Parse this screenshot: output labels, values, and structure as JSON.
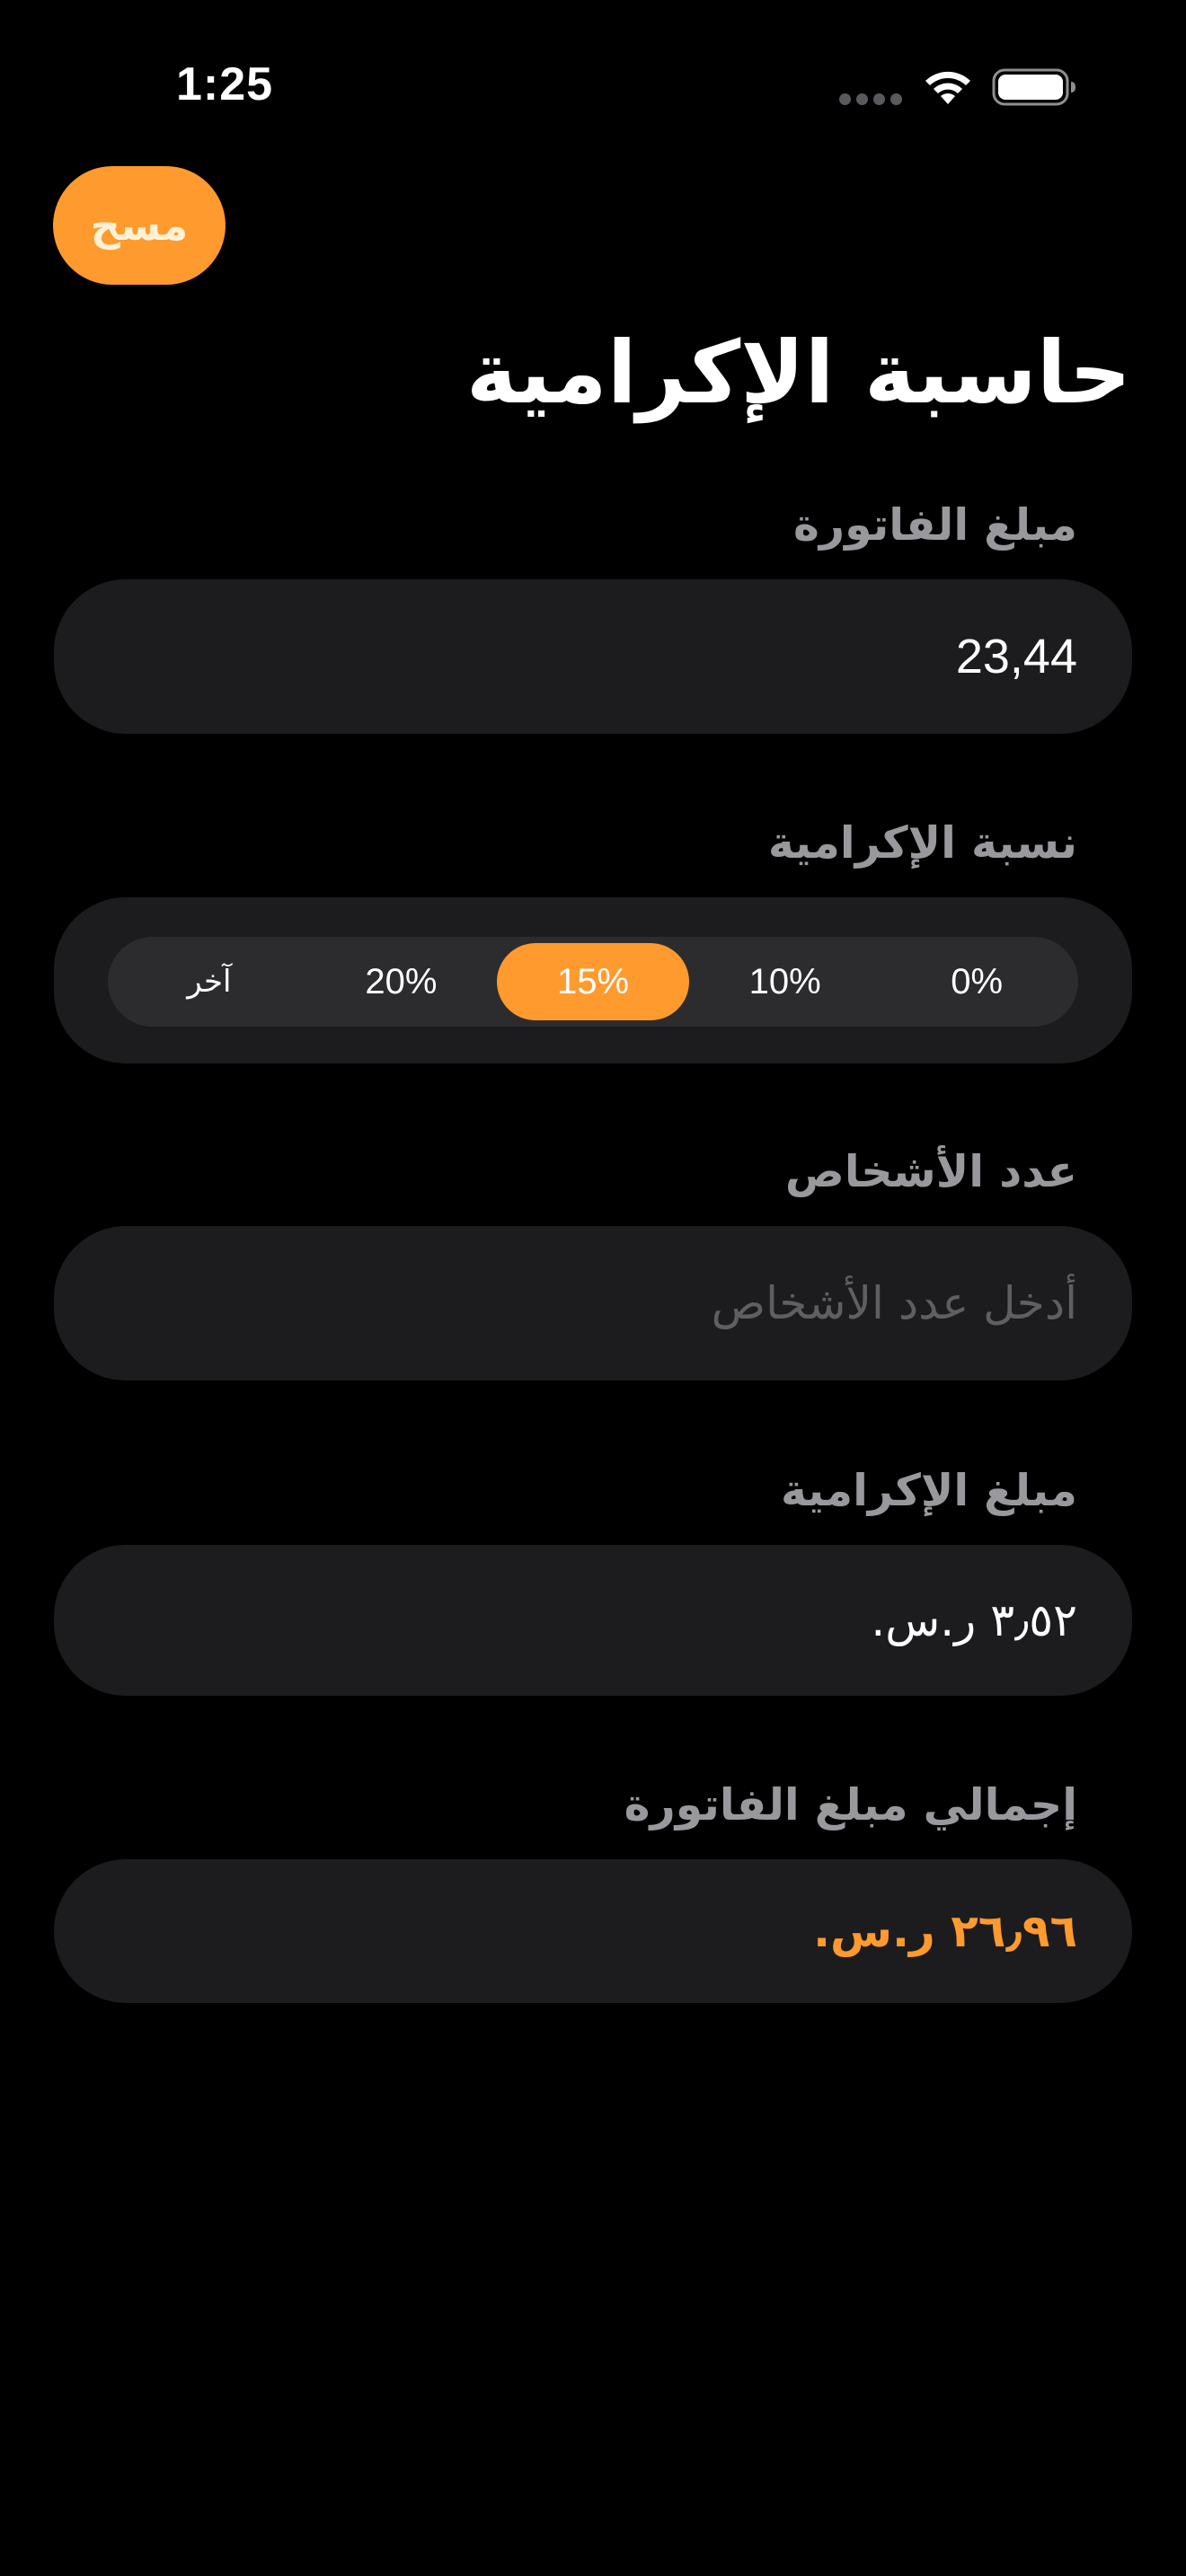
{
  "status_bar": {
    "time": "1:25"
  },
  "toolbar": {
    "clear_label": "مسح"
  },
  "page": {
    "title": "حاسبة الإكرامية"
  },
  "bill": {
    "label": "مبلغ الفاتورة",
    "value": "23,44"
  },
  "tip_percentage": {
    "label": "نسبة الإكرامية",
    "options": [
      "0%",
      "10%",
      "15%",
      "20%",
      "آخر"
    ],
    "selected": "15%"
  },
  "people": {
    "label": "عدد الأشخاص",
    "value": "",
    "placeholder": "أدخل عدد الأشخاص"
  },
  "tip_amount": {
    "label": "مبلغ الإكرامية",
    "value": "٣٫٥٢ ر.س."
  },
  "total": {
    "label": "إجمالي مبلغ الفاتورة",
    "value": "٢٦٫٩٦ ر.س."
  },
  "colors": {
    "accent": "#ff9a2e",
    "background": "#000000",
    "card": "#1c1c1e",
    "segment_track": "#2c2c2e",
    "label": "#98989d"
  },
  "icons": {
    "signal": "cellular-signal-icon",
    "wifi": "wifi-icon",
    "battery": "battery-icon"
  }
}
